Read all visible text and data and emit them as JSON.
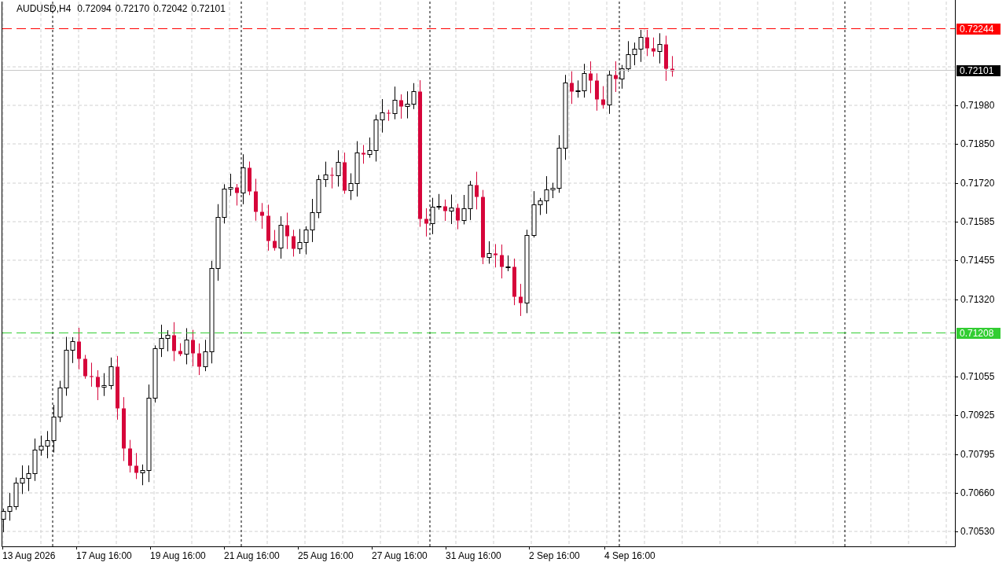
{
  "chart": {
    "symbol": "AUDUSD,H4",
    "ohlc": [
      "0.72094",
      "0.72170",
      "0.72042",
      "0.72101"
    ],
    "price_scale": [
      "0.71980",
      "0.71850",
      "0.71720",
      "0.71585",
      "0.71455",
      "0.71320",
      "0.71055",
      "0.70925",
      "0.70795",
      "0.70660",
      "0.70530"
    ],
    "price_lines": [
      {
        "label": "0.72244",
        "color": "#ff0000",
        "kind": "dashed"
      },
      {
        "label": "0.72101",
        "color": "#000000",
        "kind": "solid"
      },
      {
        "label": "0.71208",
        "color": "#32cd32",
        "kind": "dashed"
      }
    ],
    "time_scale": [
      "13 Aug 2026",
      "17 Aug 16:00",
      "19 Aug 16:00",
      "21 Aug 16:00",
      "25 Aug 16:00",
      "27 Aug 16:00",
      "31 Aug 16:00",
      "2 Sep 16:00",
      "4 Sep 16:00"
    ]
  }
}
